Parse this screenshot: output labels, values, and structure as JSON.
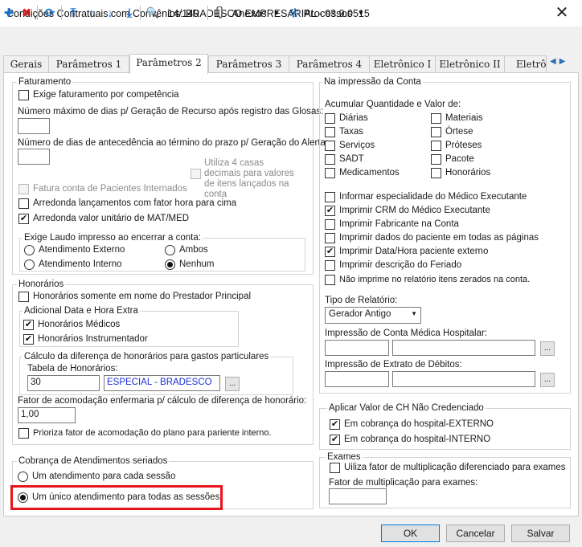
{
  "window": {
    "title": "Condições Contratuais com Convênios: BRADESCO EMPRESARIAL - 03.9.0515",
    "close": "✕"
  },
  "toolbar": {
    "add": "✚",
    "delete": "✖",
    "refresh": "⟳",
    "first": "⤒",
    "prev": "↑",
    "next": "↓",
    "last": "⤓",
    "search": "🔍",
    "counter": "14/149",
    "attachments": "Anexos",
    "processes": "Processos",
    "dropdown": "▼"
  },
  "tabs": [
    "Gerais",
    "Parâmetros 1",
    "Parâmetros 2",
    "Parâmetros 3",
    "Parâmetros 4",
    "Eletrônico I",
    "Eletrônico II",
    "Eletrôn"
  ],
  "tab_nav": {
    "prev": "◀",
    "next": "▶"
  },
  "faturamento": {
    "title": "Faturamento",
    "competencia": "Exige faturamento por competência",
    "max_dias": "Número máximo de dias p/ Geração de Recurso após registro das Glosas:",
    "dias_antecedencia": "Número de dias de antecedência ao término do prazo p/ Geração do Alerta:",
    "quatro_casas": "Utiliza 4 casas decimais para valores de itens lançados na conta",
    "fatura_internados": "Fatura conta de Pacientes Internados",
    "arredonda_fator": "Arredonda lançamentos com fator hora para cima",
    "arredonda_matmed": "Arredonda valor unitário de MAT/MED"
  },
  "laudo": {
    "title": "Exige Laudo impresso ao encerrar a conta:",
    "externo": "Atendimento Externo",
    "ambos": "Ambos",
    "interno": "Atendimento Interno",
    "nenhum": "Nenhum"
  },
  "honorarios": {
    "title": "Honorários",
    "somente_prestador": "Honorários somente em nome do Prestador Principal",
    "adicional_title": "Adicional Data e Hora Extra",
    "medicos": "Honorários Médicos",
    "instrumentador": "Honorários Instrumentador",
    "calculo_title": "Cálculo da diferença de honorários para gastos particulares",
    "tabela_label": "Tabela de Honorários:",
    "tabela_codigo": "30",
    "tabela_nome": "ESPECIAL - BRADESCO",
    "fator_label": "Fator de acomodação enfermaria p/ cálculo de diferença de honorário:",
    "fator_valor": "1,00",
    "prioriza": "Prioriza fator de acomodação do plano para pariente interno."
  },
  "cobranca": {
    "title": "Cobrança de Atendimentos seriados",
    "cada_sessao": "Um atendimento para cada sessão",
    "unico": "Um único atendimento para todas as sessões"
  },
  "impressao": {
    "title": "Na impressão da Conta",
    "acumular": "Acumular Quantidade e Valor de:",
    "diarias": "Diárias",
    "materiais": "Materiais",
    "taxas": "Taxas",
    "orteses": "Órtese",
    "servicos": "Serviços",
    "proteses": "Próteses",
    "sadt": "SADT",
    "pacote": "Pacote",
    "medicamentos": "Medicamentos",
    "honorarios": "Honorários",
    "especialidade": "Informar especialidade do Médico Executante",
    "crm": "Imprimir CRM do Médico Executante",
    "fabricante": "Imprimir Fabricante na Conta",
    "dados_paciente": "Imprimir dados do paciente em todas as páginas",
    "data_hora": "Imprimir Data/Hora paciente externo",
    "feriado": "Imprimir descrição do Feriado",
    "nao_imprime_zerados": "Não imprime no relatório itens zerados na conta.",
    "tipo_relatorio_label": "Tipo de Relatório:",
    "tipo_relatorio": "Gerador Antigo",
    "conta_medica_label": "Impressão de Conta Médica Hospitalar:",
    "extrato_label": "Impressão de Extrato de Débitos:",
    "ellipsis": "..."
  },
  "ch": {
    "title": "Aplicar Valor de CH Não Credenciado",
    "externo": "Em cobrança do hospital-EXTERNO",
    "interno": "Em cobrança do hospital-INTERNO"
  },
  "exames": {
    "title": "Exames",
    "utiliza_fator": "Uiliza fator de multiplicação diferenciado para exames",
    "fator_label": "Fator de multiplicação para exames:"
  },
  "buttons": {
    "ok": "OK",
    "cancel": "Cancelar",
    "save": "Salvar"
  }
}
